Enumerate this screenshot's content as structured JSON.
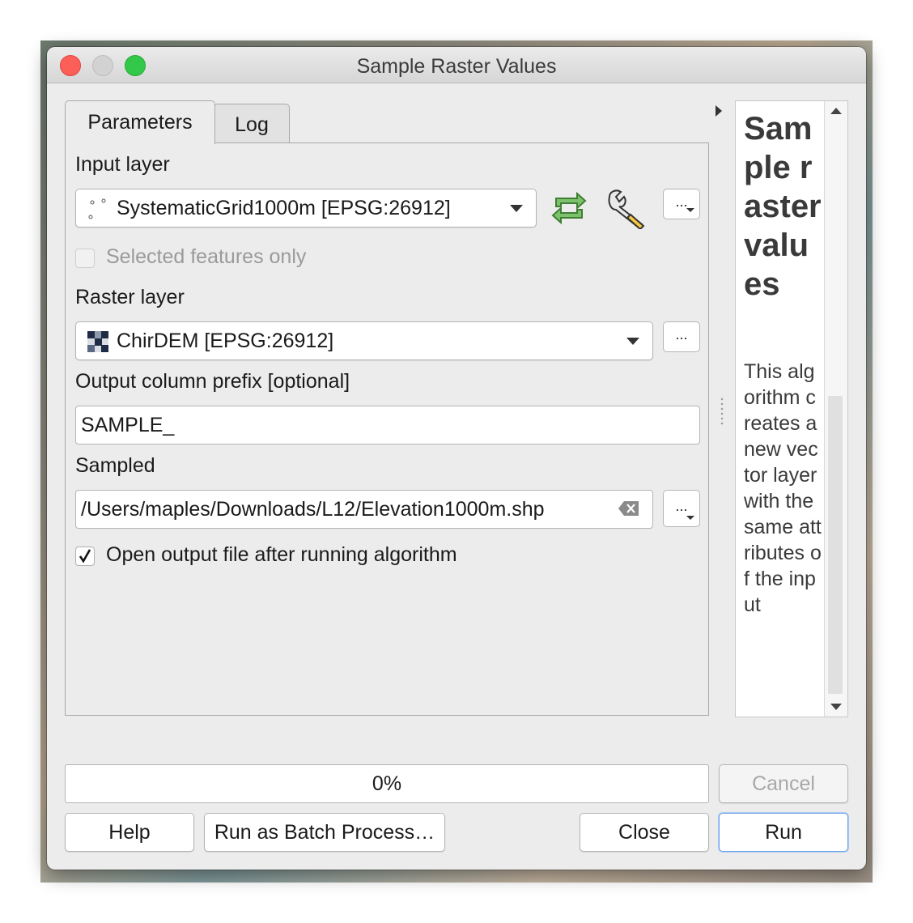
{
  "window": {
    "title": "Sample Raster Values"
  },
  "tabs": [
    {
      "label": "Parameters",
      "active": true
    },
    {
      "label": "Log",
      "active": false
    }
  ],
  "parameters": {
    "input_layer": {
      "label": "Input layer",
      "value": "SystematicGrid1000m [EPSG:26912]",
      "icon": "point-layer-icon"
    },
    "selected_only": {
      "label": "Selected features only",
      "checked": false,
      "enabled": false
    },
    "raster_layer": {
      "label": "Raster layer",
      "value": "ChirDEM [EPSG:26912]",
      "icon": "raster-layer-icon"
    },
    "prefix": {
      "label": "Output column prefix [optional]",
      "value": "SAMPLE_"
    },
    "sampled": {
      "label": "Sampled",
      "value": "/Users/maples/Downloads/L12/Elevation1000m.shp"
    },
    "open_output": {
      "label": "Open output file after running algorithm",
      "checked": true
    },
    "browse_label": "..."
  },
  "help": {
    "title": "Sample raster values",
    "body": "This algorithm creates a new vector layer with the same attributes of the input"
  },
  "progress": {
    "percent": 0,
    "text": "0%"
  },
  "buttons": {
    "cancel": "Cancel",
    "help": "Help",
    "batch": "Run as Batch Process…",
    "close": "Close",
    "run": "Run"
  },
  "colors": {
    "close": "#fc5f57",
    "minimize": "#d2d2d2",
    "maximize": "#34c84a",
    "accent": "#6fa3e6"
  }
}
